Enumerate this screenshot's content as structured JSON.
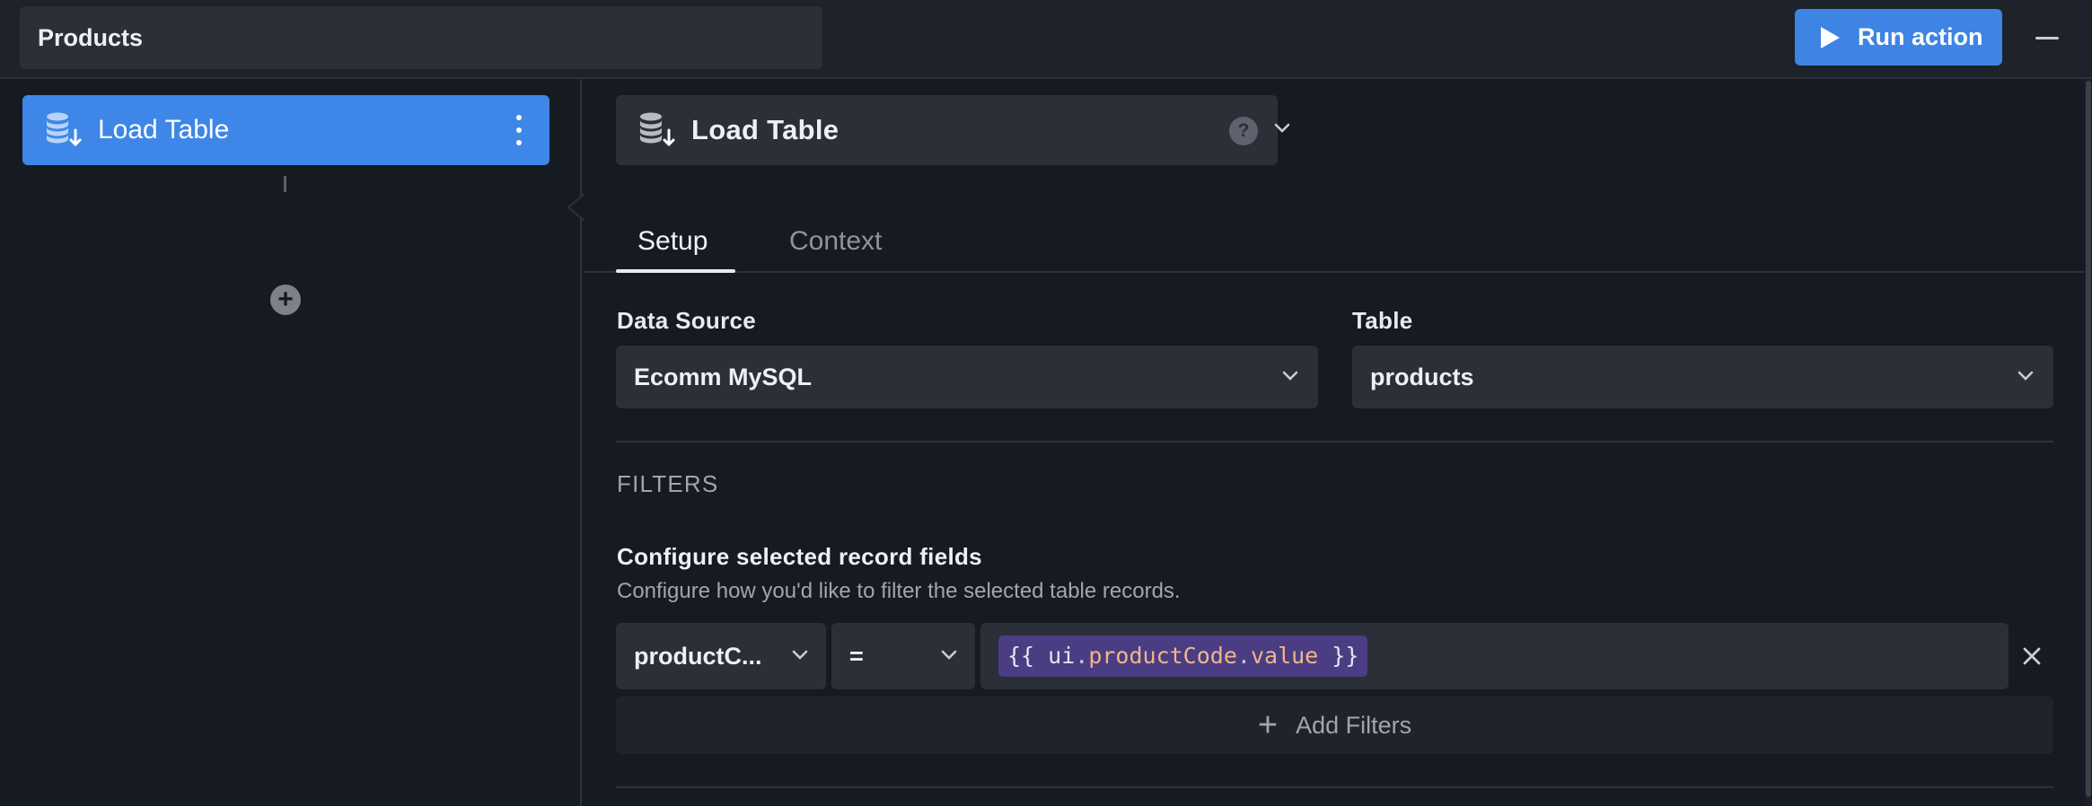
{
  "header": {
    "title": "Products",
    "run_button_label": "Run action",
    "play_icon": "play-icon",
    "minimize_icon": "minimize-icon"
  },
  "sidebar": {
    "step": {
      "label": "Load Table",
      "icon": "database-load-icon",
      "menu_icon": "kebab-menu-icon"
    },
    "add_step_icon": "plus-circle-icon"
  },
  "action": {
    "title": "Load Table",
    "help_glyph": "?",
    "tabs": [
      {
        "label": "Setup",
        "active": true
      },
      {
        "label": "Context",
        "active": false
      }
    ],
    "data_source": {
      "label": "Data Source",
      "value": "Ecomm MySQL"
    },
    "table": {
      "label": "Table",
      "value": "products"
    },
    "filters": {
      "section_title": "FILTERS",
      "subtitle": "Configure selected record fields",
      "help_text": "Configure how you'd like to filter the selected table records.",
      "rows": [
        {
          "field": "productC...",
          "operator": "=",
          "value_tokens": {
            "open": "{{ ",
            "object": "ui",
            "dot1": ".",
            "property": "productCode",
            "dot2": ".",
            "attribute": "value",
            "close": " }}"
          }
        }
      ],
      "add_label": "Add Filters"
    }
  },
  "colors": {
    "accent": "#3d84e4",
    "background": "#161a21",
    "panel": "#2b2f38",
    "chip": "#4a3d83",
    "token_highlight": "#f0b58a"
  }
}
